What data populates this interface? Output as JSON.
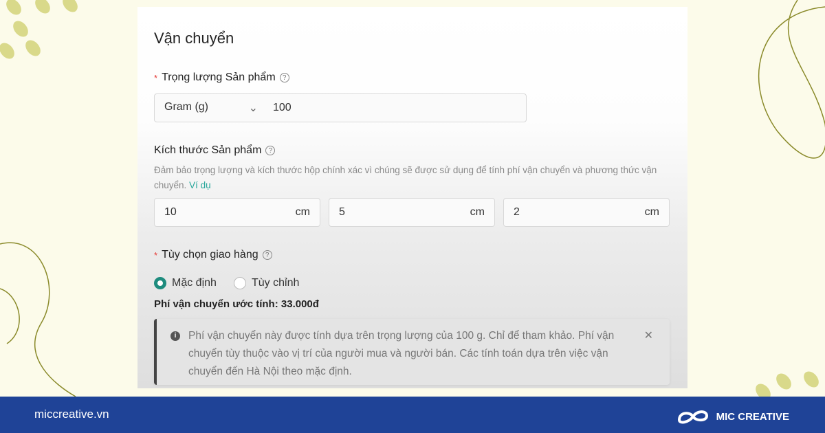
{
  "section_title": "Vận chuyển",
  "weight": {
    "label": "Trọng lượng Sản phẩm",
    "unit": "Gram (g)",
    "value": "100"
  },
  "dimensions": {
    "label": "Kích thước Sản phẩm",
    "description": "Đảm bảo trọng lượng và kích thước hộp chính xác vì chúng sẽ được sử dụng để tính phí vận chuyển và phương thức vận chuyển.",
    "example_link": "Ví dụ",
    "unit": "cm",
    "values": [
      "10",
      "5",
      "2"
    ]
  },
  "delivery": {
    "label": "Tùy chọn giao hàng",
    "options": [
      "Mặc định",
      "Tùy chỉnh"
    ],
    "selected": "Mặc định",
    "estimated_fee": "Phí vận chuyển ước tính: 33.000đ",
    "info": "Phí vận chuyển này được tính dựa trên trọng lượng của 100 g.  Chỉ để tham khảo. Phí vận chuyển tùy thuộc vào vị trí của người mua và người bán. Các tính toán dựa trên việc vận chuyển đến Hà Nội theo mặc định."
  },
  "footer": {
    "website": "miccreative.vn",
    "brand": "MIC CREATIVE",
    "color": "#1f4397"
  },
  "accent": "#1e8c7e"
}
